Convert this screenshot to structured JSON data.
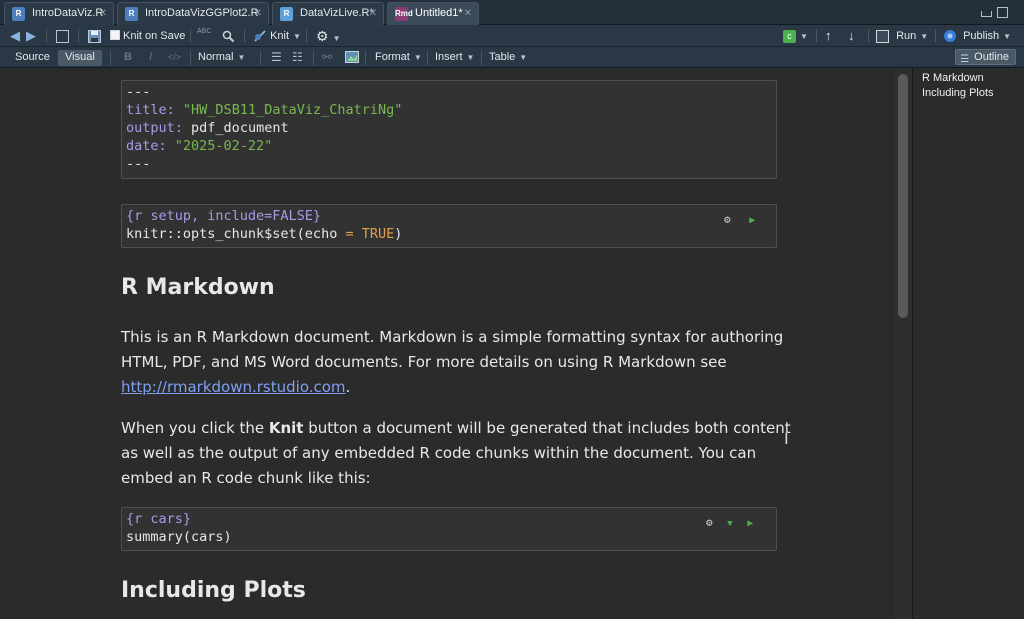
{
  "tabs": [
    {
      "label": "IntroDataViz.R",
      "type": "r"
    },
    {
      "label": "IntroDataVizGGPlot2.R",
      "type": "r"
    },
    {
      "label": "DataVizLive.R*",
      "type": "r-live"
    },
    {
      "label": "Untitled1*",
      "type": "rmd",
      "active": true
    }
  ],
  "toolbar": {
    "knit_on_save": "Knit on Save",
    "spell_abc": "ABC",
    "knit": "Knit",
    "run": "Run",
    "publish": "Publish"
  },
  "format_bar": {
    "source": "Source",
    "visual": "Visual",
    "bold": "B",
    "italic": "I",
    "code": "</>",
    "style": "Normal",
    "format": "Format",
    "insert": "Insert",
    "table": "Table",
    "outline": "Outline"
  },
  "yaml": {
    "dashes": "---",
    "title_key": "title:",
    "title_value": "\"HW_DSB11_DataViz_ChatriNg\"",
    "output_key": "output:",
    "output_value": "pdf_document",
    "date_key": "date:",
    "date_value": "\"2025-02-22\""
  },
  "setup_chunk": {
    "header": "{r setup, include=FALSE}",
    "code_prefix": "knitr::opts_chunk$set(echo ",
    "code_eq": "=",
    "code_true": "TRUE",
    "code_suffix": ")"
  },
  "heading1": "R Markdown",
  "para1_text": "This is an R Markdown document. Markdown is a simple formatting syntax for authoring HTML, PDF, and MS Word documents. For more details on using R Markdown see ",
  "para1_link": "http://rmarkdown.rstudio.com",
  "para1_end": ".",
  "para2_pre": "When you click the ",
  "para2_bold": "Knit",
  "para2_post": " button a document will be generated that includes both content as well as the output of any embedded R code chunks within the document. You can embed an R code chunk like this:",
  "cars_chunk": {
    "header": "{r cars}",
    "code": "summary(cars)"
  },
  "heading2": "Including Plots",
  "outline_items": [
    "R Markdown",
    "Including Plots"
  ],
  "colors": {
    "yaml_key": "#a89ae6",
    "string": "#78b84e",
    "keyword_true": "#e0a050",
    "link": "#7f9ff0",
    "run_green": "#4caf50"
  }
}
